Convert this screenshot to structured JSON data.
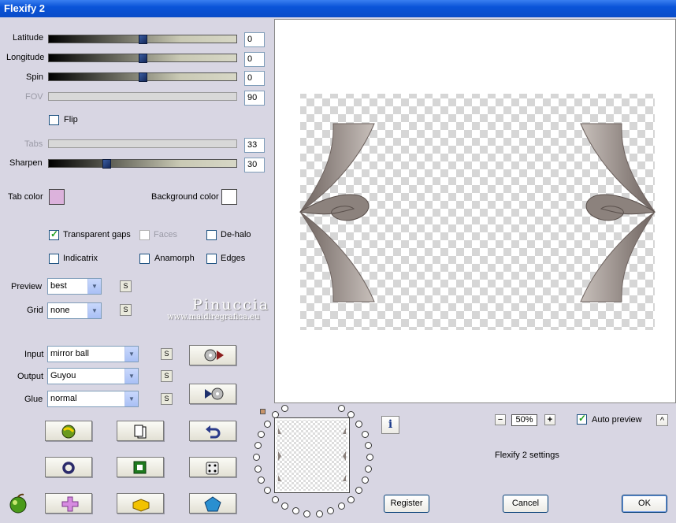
{
  "window": {
    "title": "Flexify 2"
  },
  "sliders": {
    "latitude": {
      "label": "Latitude",
      "value": "0",
      "level": 0.5
    },
    "longitude": {
      "label": "Longitude",
      "value": "0",
      "level": 0.5
    },
    "spin": {
      "label": "Spin",
      "value": "0",
      "level": 0.5
    },
    "fov": {
      "label": "FOV",
      "value": "90"
    },
    "tabs": {
      "label": "Tabs",
      "value": "33"
    },
    "sharpen": {
      "label": "Sharpen",
      "value": "30",
      "level": 0.3
    }
  },
  "flip": {
    "label": "Flip",
    "checked": false
  },
  "colors": {
    "tab_color_label": "Tab color",
    "tab_color": "#dcb2dc",
    "background_color_label": "Background color",
    "background_color": "#ffffff"
  },
  "options": {
    "transparent_gaps": {
      "label": "Transparent gaps",
      "checked": true
    },
    "faces": {
      "label": "Faces",
      "checked": false
    },
    "de_halo": {
      "label": "De-halo",
      "checked": false
    },
    "indicatrix": {
      "label": "Indicatrix",
      "checked": false
    },
    "anamorph": {
      "label": "Anamorph",
      "checked": false
    },
    "edges": {
      "label": "Edges",
      "checked": false
    }
  },
  "selects": {
    "preview": {
      "label": "Preview",
      "value": "best"
    },
    "grid": {
      "label": "Grid",
      "value": "none"
    },
    "input": {
      "label": "Input",
      "value": "mirror ball"
    },
    "output": {
      "label": "Output",
      "value": "Guyou"
    },
    "glue": {
      "label": "Glue",
      "value": "normal"
    }
  },
  "s_button_label": "S",
  "watermark": {
    "name": "Pinuccia",
    "site": "www.maidiregrafica.eu"
  },
  "zoom": {
    "value": "50%",
    "minus": "−",
    "plus": "+"
  },
  "auto_preview": {
    "label": "Auto preview",
    "checked": true,
    "collapse_label": "^"
  },
  "settings_text": "Flexify 2 settings",
  "info_label": "i",
  "buttons": {
    "register": "Register",
    "cancel": "Cancel",
    "ok": "OK"
  },
  "icons": [
    "play-forward-icon",
    "play-back-icon",
    "randomize-globe-icon",
    "copy-icon",
    "undo-icon",
    "circle-icon",
    "square-icon",
    "dice-icon",
    "plus-cross-icon",
    "brick-icon",
    "pentagon-icon",
    "apple-logo-icon"
  ],
  "accent_colors": {
    "title_bar": "#0a54d8",
    "panel": "#d8d6e3",
    "artwork": "#8c827d"
  }
}
